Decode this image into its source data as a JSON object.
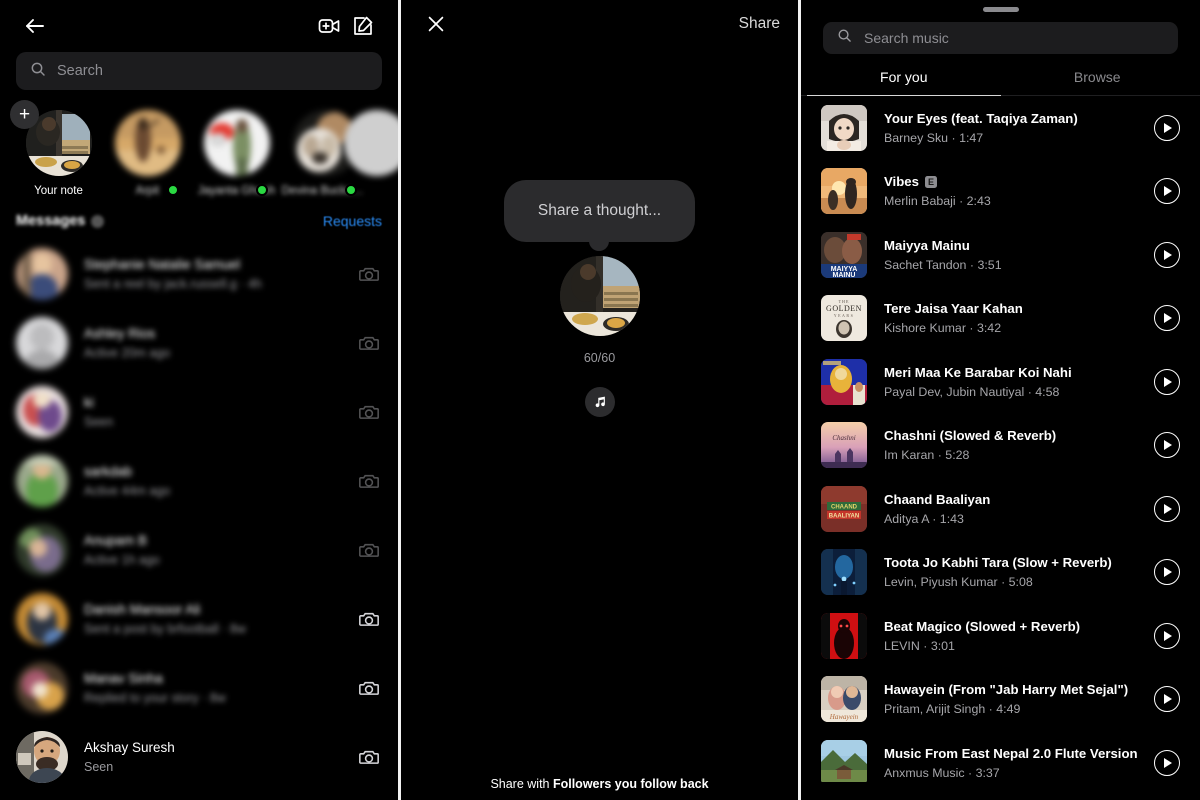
{
  "dm": {
    "header": {
      "back_icon": "back-arrow-icon",
      "video_icon": "video-call-add-icon",
      "compose_icon": "compose-icon"
    },
    "search": {
      "placeholder": "Search",
      "icon": "search-icon"
    },
    "notes": [
      {
        "label": "Your note",
        "blurred": false,
        "online": false,
        "has_plus": true
      },
      {
        "label": "Arpit",
        "blurred": true,
        "online": true,
        "has_plus": false
      },
      {
        "label": "Jayanta Ghosh",
        "blurred": true,
        "online": true,
        "has_plus": false
      },
      {
        "label": "Devina Buckshee",
        "blurred": true,
        "online": true,
        "has_plus": false
      }
    ],
    "messages_label": "Messages",
    "requests_label": "Requests",
    "threads": [
      {
        "name": "Stephanie Natalie Samuel",
        "sub": "Sent a reel by jack.russell.g · 4h",
        "blurred": true
      },
      {
        "name": "Ashley Rios",
        "sub": "Active 20m ago",
        "blurred": true
      },
      {
        "name": "ki",
        "sub": "Seen",
        "blurred": true
      },
      {
        "name": "sarkdab",
        "sub": "Active 44m ago",
        "blurred": true
      },
      {
        "name": "Anupam B",
        "sub": "Active 1h ago",
        "blurred": true
      },
      {
        "name": "Danish Mansoor Ali",
        "sub": "Sent a post by brfootball · 8w",
        "blurred": true
      },
      {
        "name": "Manav Sinha",
        "sub": "Replied to your story · 8w",
        "blurred": true
      },
      {
        "name": "Akshay Suresh",
        "sub": "Seen",
        "blurred": false
      }
    ]
  },
  "note_composer": {
    "close_icon": "close-icon",
    "share_label": "Share",
    "bubble_placeholder": "Share a thought...",
    "char_count": "60/60",
    "music_icon": "music-note-icon",
    "footer_prefix": "Share with ",
    "footer_bold": "Followers you follow back"
  },
  "music": {
    "search_placeholder": "Search music",
    "search_icon": "search-icon",
    "tabs": [
      {
        "label": "For you",
        "active": true
      },
      {
        "label": "Browse",
        "active": false
      }
    ],
    "tracks": [
      {
        "title": "Your Eyes (feat. Taqiya Zaman)",
        "artist": "Barney Sku",
        "duration": "1:47",
        "explicit": false,
        "art": "anime-girl"
      },
      {
        "title": "Vibes",
        "artist": "Merlin Babaji",
        "duration": "2:43",
        "explicit": true,
        "art": "sunset-beach"
      },
      {
        "title": "Maiyya Mainu",
        "artist": "Sachet Tandon",
        "duration": "3:51",
        "explicit": false,
        "art": "maiyya-mainu"
      },
      {
        "title": "Tere Jaisa Yaar Kahan",
        "artist": "Kishore Kumar",
        "duration": "3:42",
        "explicit": false,
        "art": "golden-years"
      },
      {
        "title": "Meri Maa Ke Barabar Koi Nahi",
        "artist": "Payal Dev, Jubin Nautiyal",
        "duration": "4:58",
        "explicit": false,
        "art": "devotional"
      },
      {
        "title": "Chashni (Slowed & Reverb)",
        "artist": "Im Karan",
        "duration": "5:28",
        "explicit": false,
        "art": "chashni"
      },
      {
        "title": "Chaand Baaliyan",
        "artist": "Aditya A",
        "duration": "1:43",
        "explicit": false,
        "art": "chaand-baaliyan"
      },
      {
        "title": "Toota Jo Kabhi Tara (Slow + Reverb)",
        "artist": "Levin, Piyush Kumar",
        "duration": "5:08",
        "explicit": false,
        "art": "blue-forest"
      },
      {
        "title": "Beat Magico (Slowed + Reverb)",
        "artist": "LEVIN",
        "duration": "3:01",
        "explicit": false,
        "art": "red-silhouette"
      },
      {
        "title": "Hawayein (From \"Jab Harry Met Sejal\")",
        "artist": "Pritam, Arijit Singh",
        "duration": "4:49",
        "explicit": false,
        "art": "hawayein"
      },
      {
        "title": "Music From East Nepal 2.0 Flute Version",
        "artist": "Anxmus Music",
        "duration": "3:37",
        "explicit": false,
        "art": "mountain"
      }
    ]
  },
  "colors": {
    "accent_blue": "#2a8cf5",
    "online_green": "#2ad942",
    "surface": "#1c1c1e",
    "bubble": "#2b2b2d",
    "muted_text": "#8e8e93"
  }
}
